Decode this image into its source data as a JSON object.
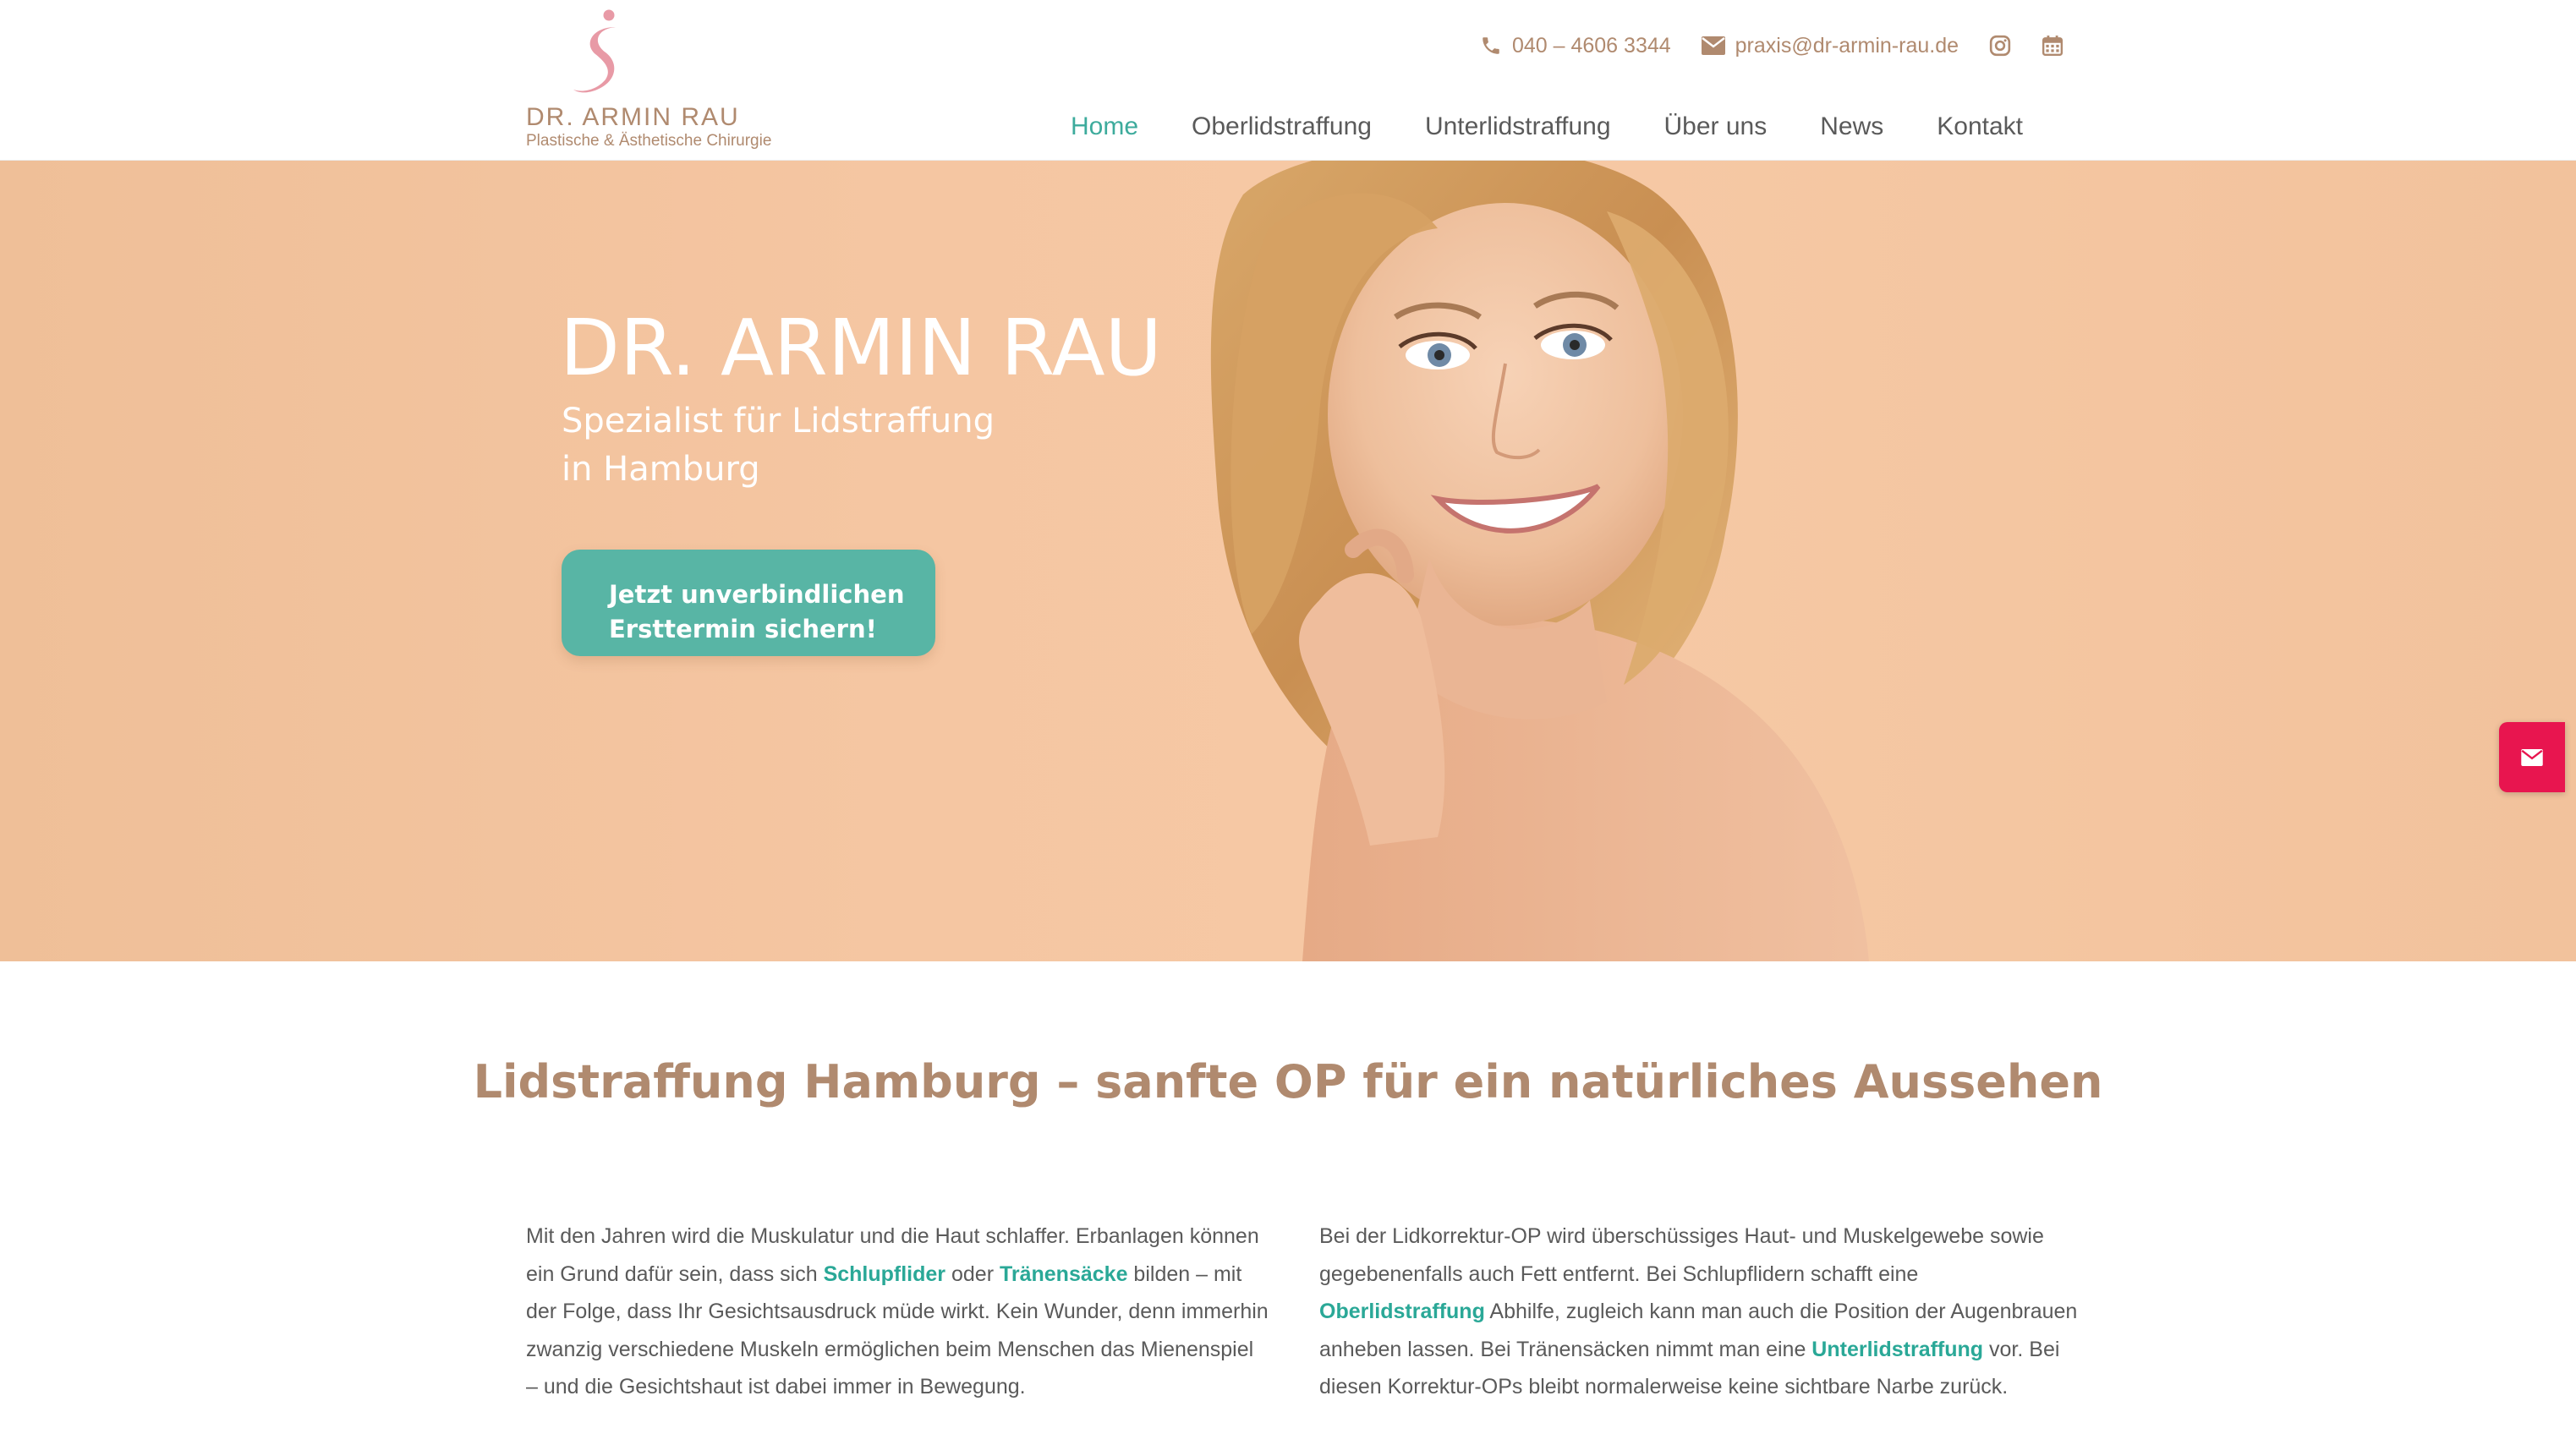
{
  "logo": {
    "name": "DR. ARMIN RAU",
    "subtitle": "Plastische & Ästhetische Chirurgie"
  },
  "topbar": {
    "phone": "040 – 4606 3344",
    "email": "praxis@dr-armin-rau.de",
    "icons": [
      "phone-icon",
      "envelope-icon",
      "instagram-icon",
      "calendar-icon"
    ]
  },
  "nav": {
    "items": [
      {
        "label": "Home",
        "active": true
      },
      {
        "label": "Oberlidstraffung",
        "active": false
      },
      {
        "label": "Unterlidstraffung",
        "active": false
      },
      {
        "label": "Über uns",
        "active": false
      },
      {
        "label": "News",
        "active": false
      },
      {
        "label": "Kontakt",
        "active": false
      }
    ]
  },
  "hero": {
    "title": "DR. ARMIN RAU",
    "subtitle_line1": "Spezialist für Lidstraffung",
    "subtitle_line2": "in Hamburg",
    "cta_line1": "Jetzt unverbindlichen",
    "cta_line2": "Ersttermin sichern!"
  },
  "section": {
    "title": "Lidstraffung Hamburg – sanfte OP für ein natürliches Aussehen"
  },
  "col_left": {
    "t1": "Mit den Jahren wird die Muskulatur und die Haut schlaffer. Erbanlagen können ein Grund dafür sein, dass sich ",
    "link1": "Schlupflider",
    "t2": " oder ",
    "link2": "Tränensäcke",
    "t3": " bilden – mit der Folge, dass Ihr Gesichtsausdruck müde wirkt. Kein Wunder, denn immerhin zwanzig verschiedene Muskeln ermöglichen beim Menschen das Mienenspiel – und die Gesichtshaut ist dabei immer in Bewegung."
  },
  "col_right": {
    "t1": "Bei der Lidkorrektur-OP wird überschüssiges Haut- und Muskelgewebe sowie gegebenenfalls auch Fett entfernt. Bei Schlupflidern schafft eine ",
    "link1": "Oberlidstraffung",
    "t2": " Abhilfe, zugleich kann man auch die Position der Augenbrauen anheben lassen. Bei Tränensäcken nimmt man eine ",
    "link2": "Unterlidstraffung",
    "t3": " vor. Bei diesen Korrektur-OPs bleibt normalerweise keine sichtbare Narbe zurück."
  },
  "colors": {
    "accent_teal": "#3dab9c",
    "brand_tan": "#b08a6f",
    "cta_green": "#58b5a5",
    "mail_red": "#e8154f",
    "hero_peach": "#f5c6a2"
  }
}
